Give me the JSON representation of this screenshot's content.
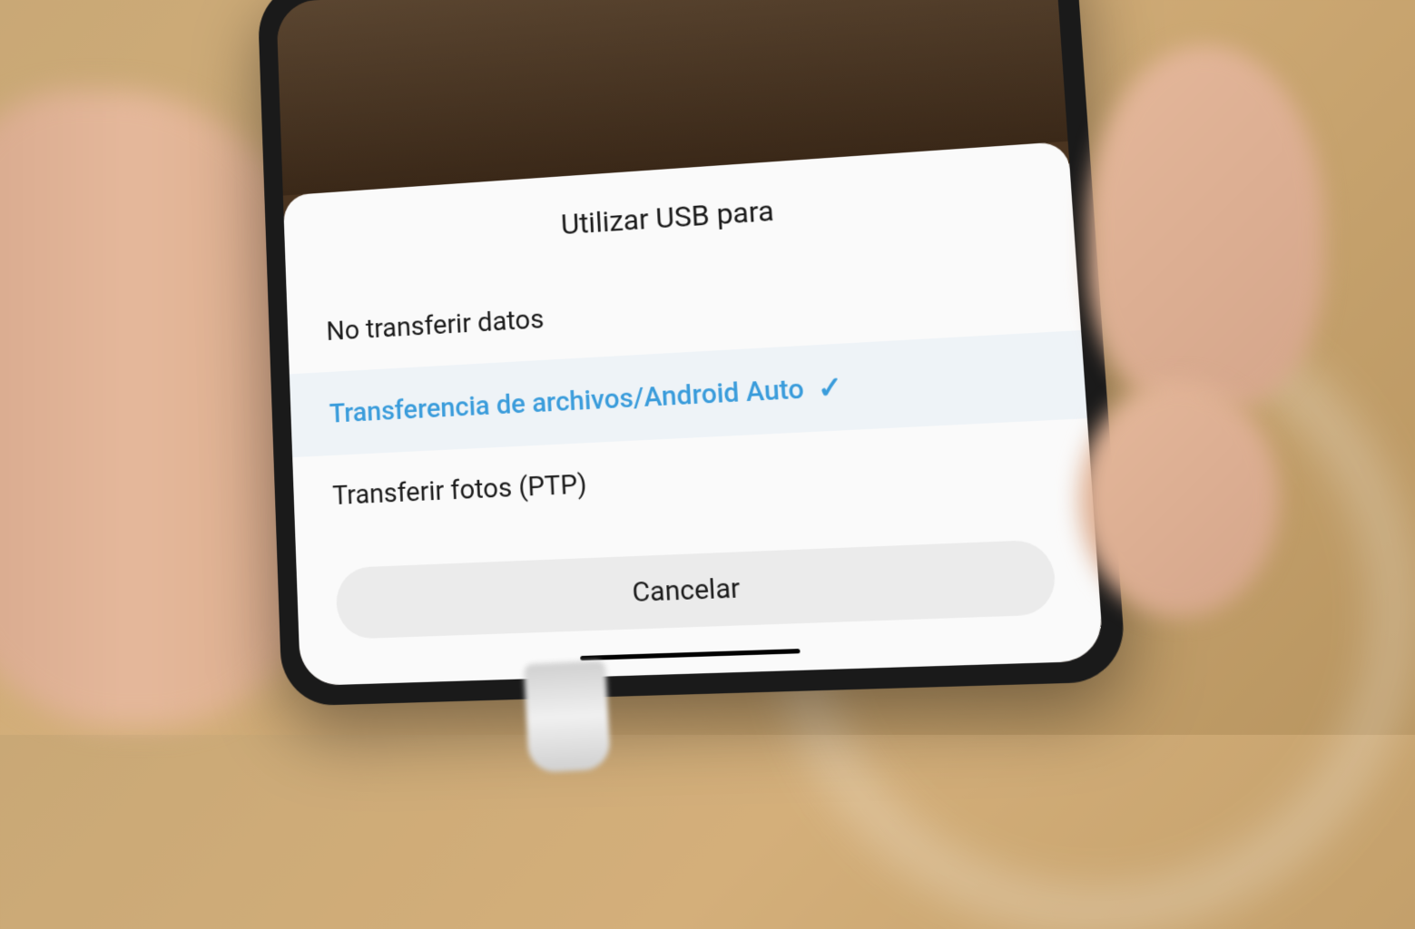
{
  "dialog": {
    "title": "Utilizar USB para",
    "options": [
      {
        "label": "No transferir datos",
        "selected": false
      },
      {
        "label": "Transferencia de archivos/Android Auto",
        "selected": true
      },
      {
        "label": "Transferir fotos (PTP)",
        "selected": false
      }
    ],
    "cancel_label": "Cancelar"
  },
  "colors": {
    "accent": "#3a9cdb",
    "selected_bg": "#eef3f7",
    "cancel_bg": "#ebebeb"
  }
}
